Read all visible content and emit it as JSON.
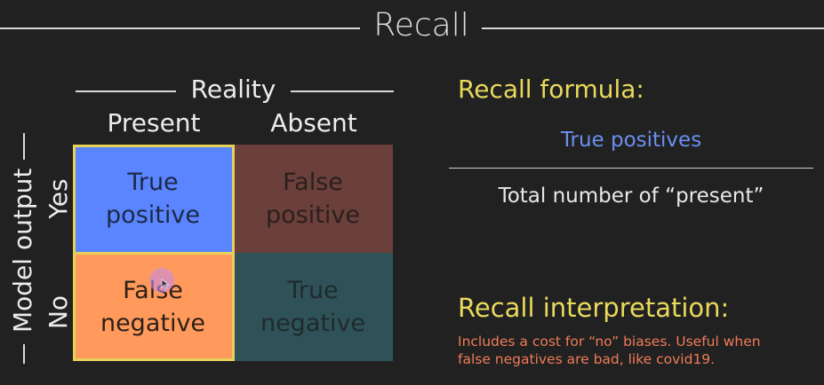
{
  "title": "Recall",
  "matrix": {
    "reality_label": "Reality",
    "columns": [
      "Present",
      "Absent"
    ],
    "model_output_label": "Model output",
    "rows": [
      "Yes",
      "No"
    ],
    "cells": {
      "tp": {
        "line1": "True",
        "line2": "positive",
        "color": "#5b84ff"
      },
      "fp": {
        "line1": "False",
        "line2": "positive",
        "color": "#6b3f3a"
      },
      "fn": {
        "line1": "False",
        "line2": "negative",
        "color": "#ff9a5c"
      },
      "tn": {
        "line1": "True",
        "line2": "negative",
        "color": "#2f5259"
      }
    },
    "highlight_color": "#e6d15a"
  },
  "formula": {
    "title": "Recall formula:",
    "numerator": "True positives",
    "denominator": "Total number of “present”"
  },
  "interpretation": {
    "title": "Recall interpretation:",
    "line1": "Includes a cost for “no” biases. Useful when",
    "line2": "false negatives are bad, like covid19."
  }
}
